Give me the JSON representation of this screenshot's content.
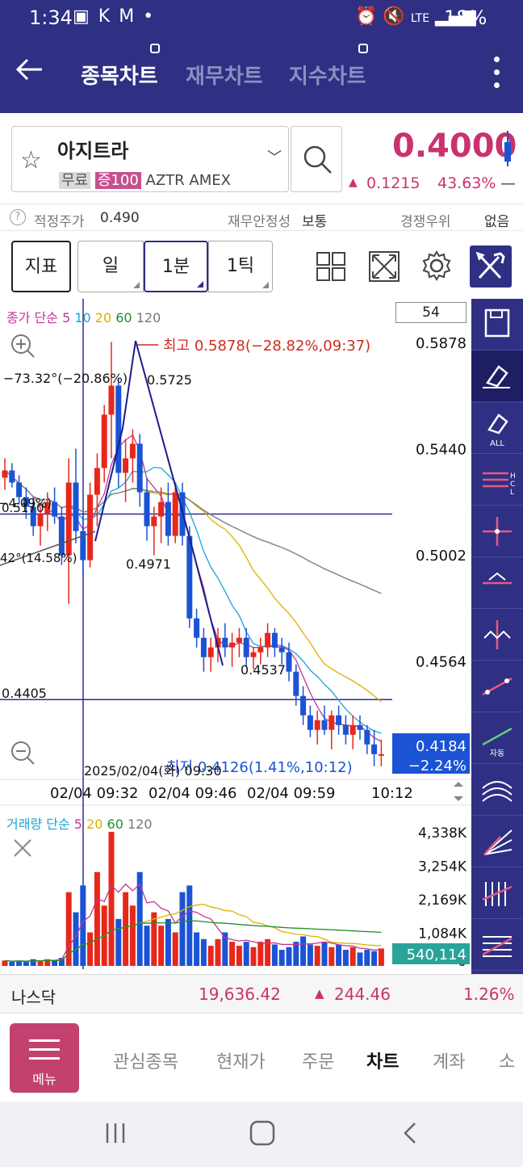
{
  "status_bar": {
    "time": "1:34",
    "left_icons": "▣ K M •",
    "signal": "LTE",
    "battery": "18%"
  },
  "header": {
    "tabs": [
      {
        "label": "종목차트",
        "active": true
      },
      {
        "label": "재무차트",
        "active": false
      },
      {
        "label": "지수차트",
        "active": false
      }
    ]
  },
  "stock": {
    "name": "아지트라",
    "tag_free": "무료",
    "tag_margin": "증100",
    "ticker": "AZTR",
    "exchange": "AMEX",
    "price": "0.4000",
    "change_arrow": "▲",
    "change": "0.1215",
    "change_pct": "43.63%",
    "change_dash": "—"
  },
  "info_bar": {
    "help": "?",
    "fair_price_label": "적정주가",
    "fair_price_value": "0.490",
    "fin_stability_label": "재무안정성",
    "fin_stability_value": "보통",
    "competition_label": "경쟁우위",
    "competition_value": "없음"
  },
  "toolbar": {
    "indicator_label": "지표",
    "day_label": "일",
    "one_min_label": "1분",
    "one_tick_label": "1틱"
  },
  "chart_data": {
    "type": "candlestick",
    "interval": "1분",
    "period_count": "54",
    "legend_main": {
      "prefix": "종가 단순",
      "ma": [
        "5",
        "10",
        "20",
        "60",
        "120"
      ]
    },
    "legend_volume": {
      "prefix": "거래량 단순",
      "ma": [
        "5",
        "20",
        "60",
        "120"
      ]
    },
    "y_ticks": [
      "0.5878",
      "0.5440",
      "0.5002",
      "0.4564"
    ],
    "ylim": [
      0.4126,
      0.5878
    ],
    "x_ticks": [
      "02/04 09:32",
      "02/04 09:46",
      "02/04 09:59",
      "10:12"
    ],
    "high_label": "최고 0.5878(−28.82%,09:37)",
    "low_label": "최저 0.4126(1.41%,10:12)",
    "crosshair_time": "2025/02/04(화) 09:30",
    "annotations": [
      "−73.32°(−20.86%)",
      "0.5725",
      "−4.09%)",
      "0.5170",
      "42°(14.58%)",
      "0.4971",
      "0.4537",
      "0.4405"
    ],
    "current_price_box": {
      "price": "0.4184",
      "pct": "−2.24%"
    },
    "horizontal_lines": [
      0.517,
      0.4405
    ],
    "volume_ticks": [
      "4,338K",
      "3,254K",
      "2,169K",
      "1,084K",
      "0"
    ],
    "volume_current": "540,114",
    "candles": [
      [
        0.532,
        0.54,
        0.527,
        0.535
      ],
      [
        0.535,
        0.538,
        0.528,
        0.53
      ],
      [
        0.53,
        0.533,
        0.521,
        0.524
      ],
      [
        0.524,
        0.528,
        0.515,
        0.52
      ],
      [
        0.52,
        0.524,
        0.508,
        0.512
      ],
      [
        0.512,
        0.52,
        0.504,
        0.517
      ],
      [
        0.517,
        0.526,
        0.51,
        0.522
      ],
      [
        0.522,
        0.528,
        0.513,
        0.516
      ],
      [
        0.516,
        0.52,
        0.496,
        0.5
      ],
      [
        0.5,
        0.54,
        0.48,
        0.53
      ],
      [
        0.53,
        0.544,
        0.505,
        0.51
      ],
      [
        0.51,
        0.516,
        0.492,
        0.498
      ],
      [
        0.498,
        0.53,
        0.495,
        0.525
      ],
      [
        0.525,
        0.542,
        0.512,
        0.536
      ],
      [
        0.536,
        0.562,
        0.53,
        0.558
      ],
      [
        0.558,
        0.588,
        0.54,
        0.57
      ],
      [
        0.57,
        0.573,
        0.528,
        0.534
      ],
      [
        0.534,
        0.548,
        0.522,
        0.54
      ],
      [
        0.54,
        0.552,
        0.53,
        0.546
      ],
      [
        0.546,
        0.55,
        0.52,
        0.526
      ],
      [
        0.526,
        0.532,
        0.506,
        0.512
      ],
      [
        0.512,
        0.52,
        0.5,
        0.516
      ],
      [
        0.516,
        0.528,
        0.505,
        0.522
      ],
      [
        0.522,
        0.53,
        0.504,
        0.508
      ],
      [
        0.508,
        0.53,
        0.505,
        0.526
      ],
      [
        0.526,
        0.53,
        0.504,
        0.508
      ],
      [
        0.508,
        0.512,
        0.47,
        0.474
      ],
      [
        0.474,
        0.478,
        0.462,
        0.466
      ],
      [
        0.466,
        0.47,
        0.452,
        0.458
      ],
      [
        0.458,
        0.466,
        0.452,
        0.462
      ],
      [
        0.462,
        0.47,
        0.456,
        0.466
      ],
      [
        0.466,
        0.472,
        0.458,
        0.462
      ],
      [
        0.462,
        0.468,
        0.454,
        0.464
      ],
      [
        0.464,
        0.47,
        0.458,
        0.466
      ],
      [
        0.466,
        0.47,
        0.454,
        0.458
      ],
      [
        0.458,
        0.462,
        0.453,
        0.46
      ],
      [
        0.46,
        0.466,
        0.455,
        0.462
      ],
      [
        0.462,
        0.472,
        0.458,
        0.468
      ],
      [
        0.468,
        0.47,
        0.458,
        0.462
      ],
      [
        0.462,
        0.466,
        0.455,
        0.46
      ],
      [
        0.46,
        0.464,
        0.448,
        0.452
      ],
      [
        0.452,
        0.455,
        0.438,
        0.442
      ],
      [
        0.442,
        0.446,
        0.43,
        0.434
      ],
      [
        0.434,
        0.438,
        0.425,
        0.428
      ],
      [
        0.428,
        0.436,
        0.422,
        0.432
      ],
      [
        0.432,
        0.438,
        0.426,
        0.428
      ],
      [
        0.428,
        0.436,
        0.42,
        0.434
      ],
      [
        0.434,
        0.438,
        0.426,
        0.43
      ],
      [
        0.43,
        0.434,
        0.422,
        0.426
      ],
      [
        0.426,
        0.434,
        0.42,
        0.43
      ],
      [
        0.43,
        0.434,
        0.424,
        0.428
      ],
      [
        0.428,
        0.43,
        0.418,
        0.422
      ],
      [
        0.422,
        0.428,
        0.413,
        0.418
      ],
      [
        0.418,
        0.424,
        0.413,
        0.418
      ]
    ],
    "volumes": [
      0.04,
      0.03,
      0.04,
      0.03,
      0.05,
      0.04,
      0.05,
      0.04,
      0.06,
      0.55,
      0.4,
      0.6,
      0.25,
      0.7,
      0.45,
      1.0,
      0.35,
      0.55,
      0.45,
      0.7,
      0.3,
      0.4,
      0.3,
      0.35,
      0.25,
      0.55,
      0.6,
      0.25,
      0.2,
      0.15,
      0.2,
      0.25,
      0.18,
      0.15,
      0.18,
      0.14,
      0.18,
      0.2,
      0.16,
      0.12,
      0.14,
      0.18,
      0.22,
      0.16,
      0.15,
      0.18,
      0.14,
      0.16,
      0.12,
      0.14,
      0.1,
      0.12,
      0.11,
      0.13
    ]
  },
  "sidebar_tools": [
    "save-icon",
    "eraser-icon",
    "eraser-all-icon",
    "hcl-icon",
    "cross-line-icon",
    "horizontal-line-icon",
    "vertical-line-icon",
    "trend-line-icon",
    "auto-trend-icon",
    "arc-icon",
    "fan-icon",
    "speed-line-icon",
    "fibonacci-icon"
  ],
  "sidebar_auto_label": "자동",
  "sidebar_all_label": "ALL",
  "market_index": {
    "name": "나스닥",
    "value": "19,636.42",
    "arrow": "▲",
    "change": "244.46",
    "pct": "1.26%"
  },
  "bottom_nav": {
    "menu_label": "메뉴",
    "items": [
      "관심종목",
      "현재가",
      "주문",
      "차트",
      "계좌",
      "소"
    ]
  },
  "colors": {
    "brand": "#2f2f84",
    "up": "#e8271b",
    "down": "#1b53d4",
    "accent": "#c9326f"
  }
}
